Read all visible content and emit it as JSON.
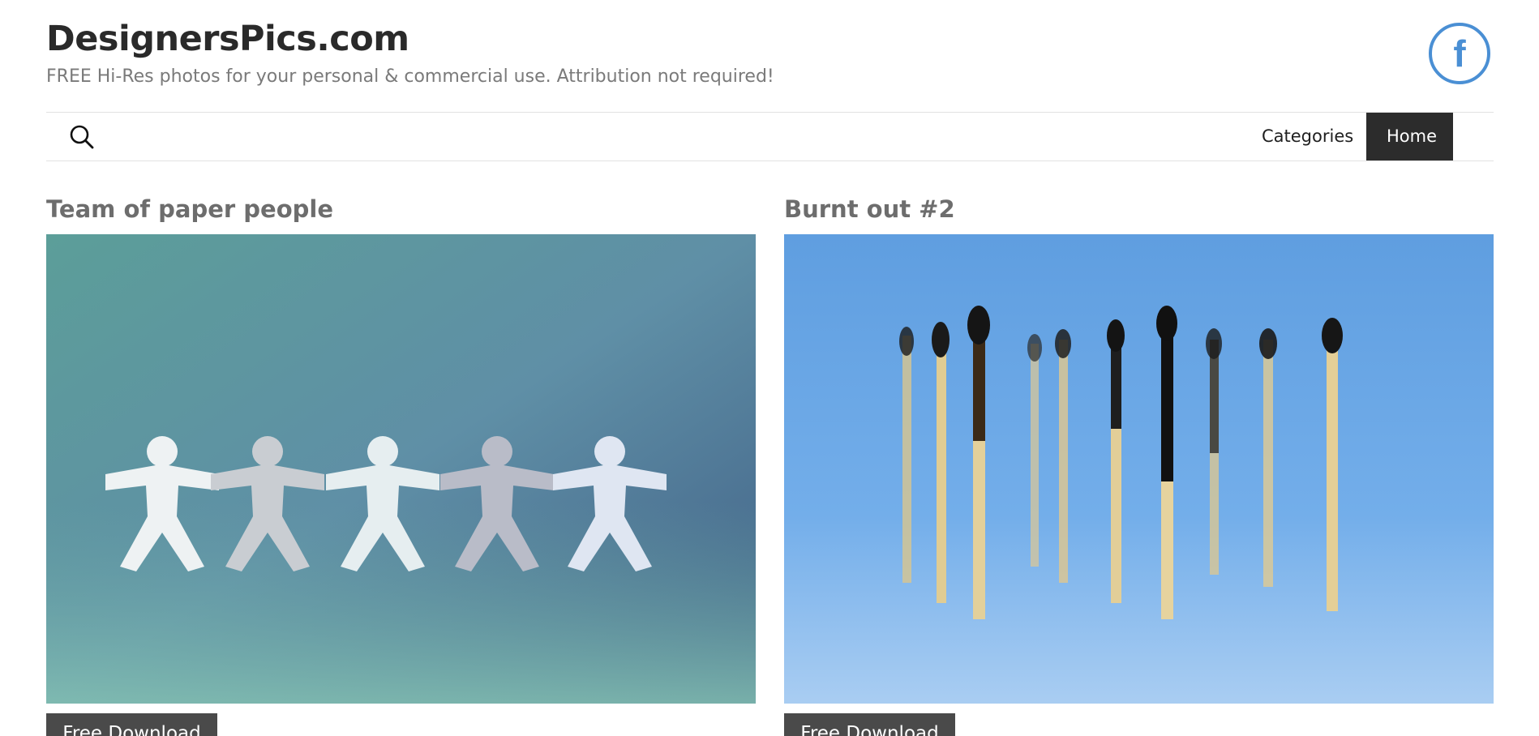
{
  "site": {
    "title": "DesignersPics.com",
    "tagline": "FREE Hi-Res photos for your personal & commercial use. Attribution not required!",
    "facebook_glyph": "f",
    "accent_color": "#4a8fd4"
  },
  "nav": {
    "search_icon": "search-icon",
    "items": [
      {
        "label": "Categories",
        "active": false
      },
      {
        "label": "Home",
        "active": true
      }
    ]
  },
  "posts": [
    {
      "title": "Team of paper people",
      "image": "paper-people-chain-photo",
      "download_label": "Free Download"
    },
    {
      "title": "Burnt out #2",
      "image": "burnt-matches-photo",
      "download_label": "Free Download"
    }
  ]
}
